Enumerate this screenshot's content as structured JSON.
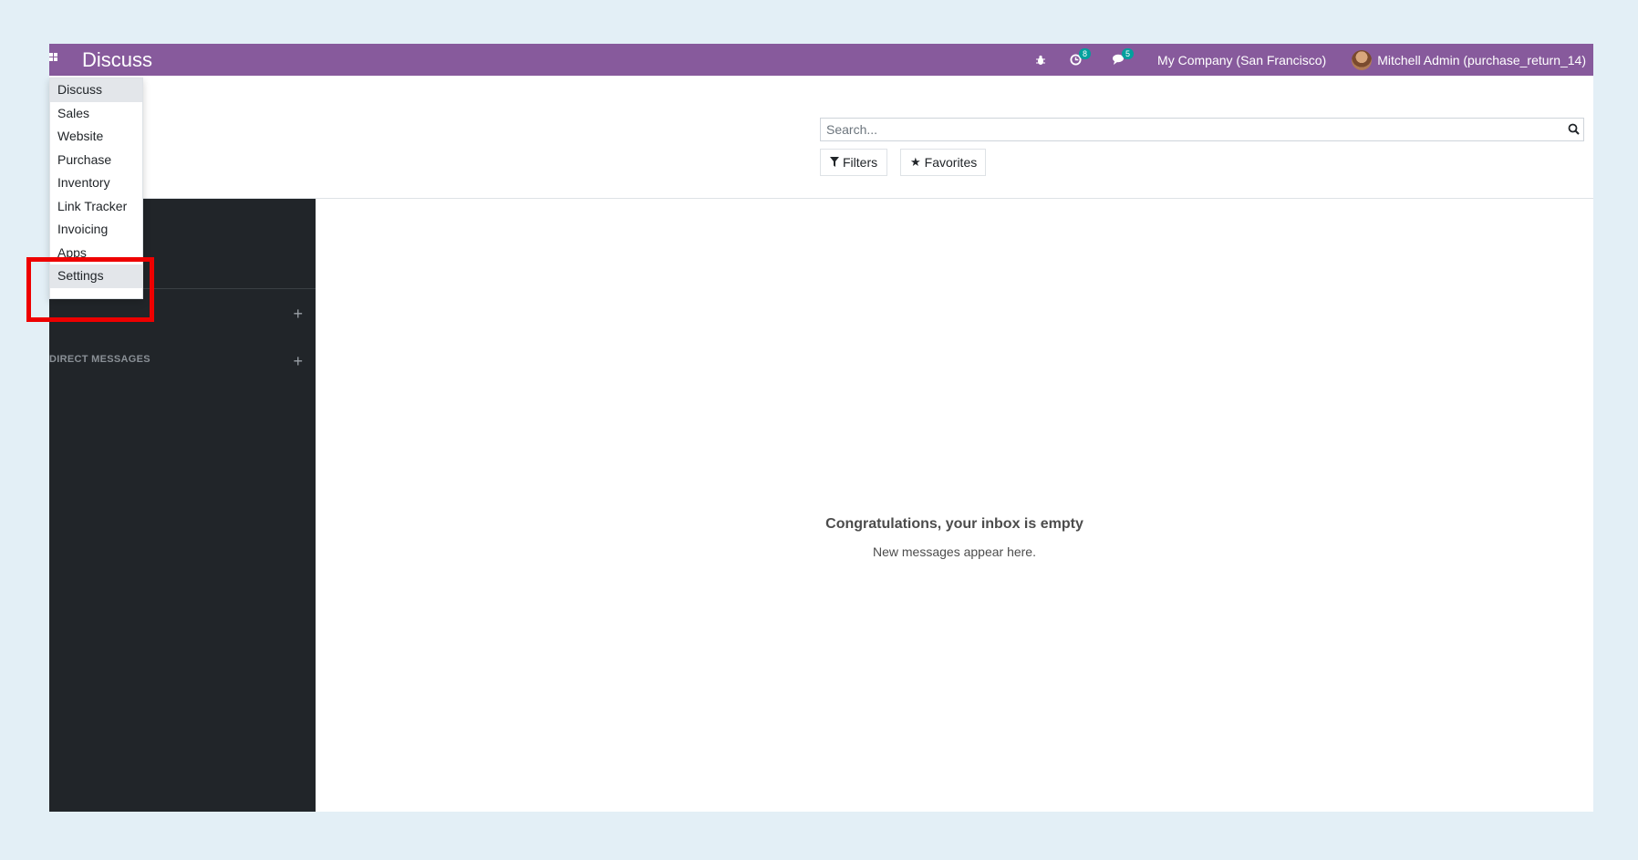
{
  "navbar": {
    "app_title": "Discuss",
    "activity_badge": "8",
    "messages_badge": "5",
    "company": "My Company (San Francisco)",
    "user": "Mitchell Admin (purchase_return_14)",
    "icons": [
      "apps-icon",
      "bug-icon",
      "clock-icon",
      "chat-icon"
    ],
    "color": "#875a9c"
  },
  "control_panel": {
    "search_placeholder": "Search...",
    "filters_label": "Filters",
    "favorites_label": "Favorites"
  },
  "app_menu": {
    "items": [
      "Discuss",
      "Sales",
      "Website",
      "Purchase",
      "Inventory",
      "Link Tracker",
      "Invoicing",
      "Apps",
      "Settings"
    ]
  },
  "sidebar": {
    "direct_messages_label": "DIRECT MESSAGES"
  },
  "empty_state": {
    "title": "Congratulations, your inbox is empty",
    "subtitle": "New messages appear here."
  },
  "colors": {
    "highlight": "#ee0000",
    "sidebar_bg": "#212529"
  }
}
